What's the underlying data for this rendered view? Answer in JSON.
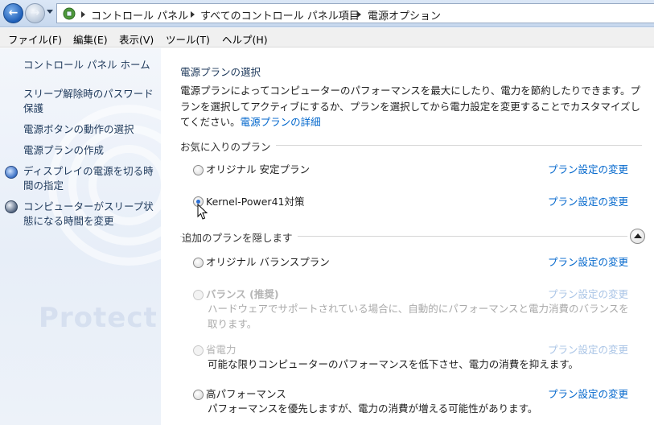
{
  "address_bar": {
    "crumbs": [
      "コントロール パネル",
      "すべてのコントロール パネル項目",
      "電源オプション"
    ]
  },
  "menu": {
    "items": [
      "ファイル(F)",
      "編集(E)",
      "表示(V)",
      "ツール(T)",
      "ヘルプ(H)"
    ]
  },
  "sidebar": {
    "home": "コントロール パネル ホーム",
    "links": [
      "スリープ解除時のパスワード保護",
      "電源ボタンの動作の選択",
      "電源プランの作成",
      "ディスプレイの電源を切る時間の指定",
      "コンピューターがスリープ状態になる時間を変更"
    ],
    "watermark": "Protect m"
  },
  "main": {
    "title": "電源プランの選択",
    "description": "電源プランによってコンピューターのパフォーマンスを最大にしたり、電力を節約したりできます。プランを選択してアクティブにするか、プランを選択してから電力設定を変更することでカスタマイズしてください。",
    "more_link": "電源プランの詳細",
    "favorites_heading": "お気に入りのプラン",
    "hidden_heading": "追加のプランを隠します",
    "change_link": "プラン設定の変更",
    "favorite_plans": [
      {
        "name": "オリジナル 安定プラン",
        "checked": false
      },
      {
        "name": "Kernel-Power41対策",
        "checked": true
      }
    ],
    "extra_plans": [
      {
        "name": "オリジナル バランスプラン",
        "desc": "",
        "disabled": false
      },
      {
        "name": "バランス (推奨)",
        "desc": "ハードウェアでサポートされている場合に、自動的にパフォーマンスと電力消費のバランスを取ります。",
        "disabled": true
      },
      {
        "name": "省電力",
        "desc": "可能な限りコンピューターのパフォーマンスを低下させ、電力の消費を抑えます。",
        "disabled": true
      },
      {
        "name": "高パフォーマンス",
        "desc": "パフォーマンスを優先しますが、電力の消費が増える可能性があります。",
        "disabled": false
      }
    ]
  },
  "colors": {
    "link": "#0066cc",
    "nav_link": "#1e395b",
    "disabled": "#b5b5b5"
  }
}
